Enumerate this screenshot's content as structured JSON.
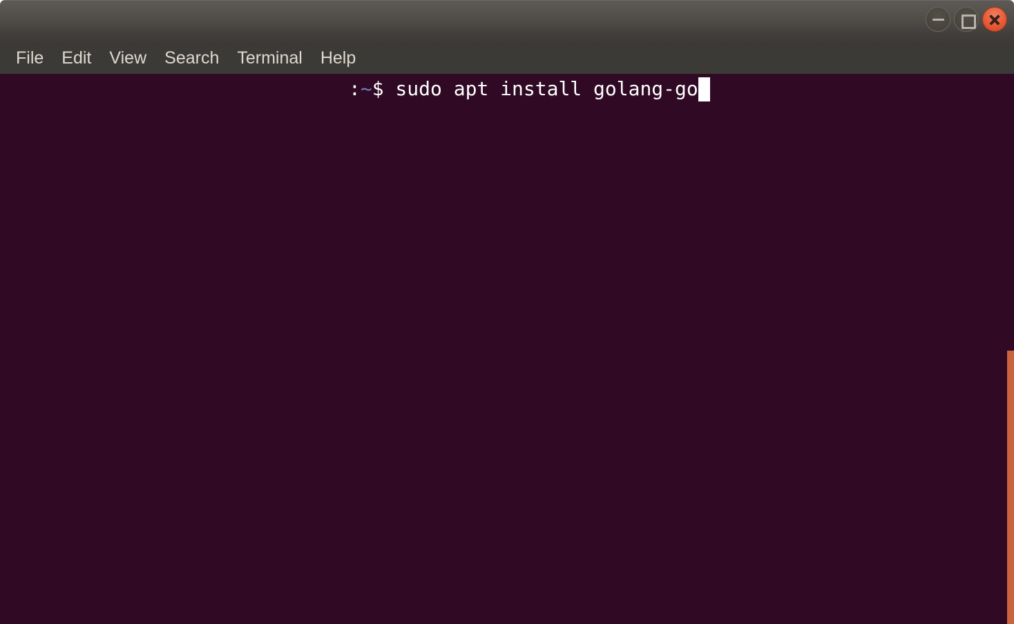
{
  "window": {
    "title": "",
    "controls": [
      {
        "name": "minimize-button",
        "icon": "minimize-icon",
        "label": "Minimize"
      },
      {
        "name": "maximize-button",
        "icon": "maximize-icon",
        "label": "Maximize"
      },
      {
        "name": "close-button",
        "icon": "close-icon",
        "label": "Close"
      }
    ],
    "colors": {
      "titlebar_top": "#5d5a55",
      "titlebar_bottom": "#3c3a37",
      "menubar": "#3c3a37",
      "terminal_background": "#300a24",
      "close_button": "#e65a36",
      "scrollbar_thumb": "#cc6340",
      "text": "#ffffff",
      "menu_text": "#dfd9cf",
      "prompt_path": "#7080b8"
    }
  },
  "menubar": {
    "items": [
      {
        "label": "File"
      },
      {
        "label": "Edit"
      },
      {
        "label": "View"
      },
      {
        "label": "Search"
      },
      {
        "label": "Terminal"
      },
      {
        "label": "Help"
      }
    ]
  },
  "terminal": {
    "prompt": {
      "colon": ":",
      "path": "~",
      "dollar": "$"
    },
    "command": " sudo apt install golang-go",
    "cursor": "block",
    "lines": [
      ":~$ sudo apt install golang-go"
    ]
  },
  "scrollbar": {
    "orientation": "vertical",
    "thumb_position": "bottom"
  }
}
